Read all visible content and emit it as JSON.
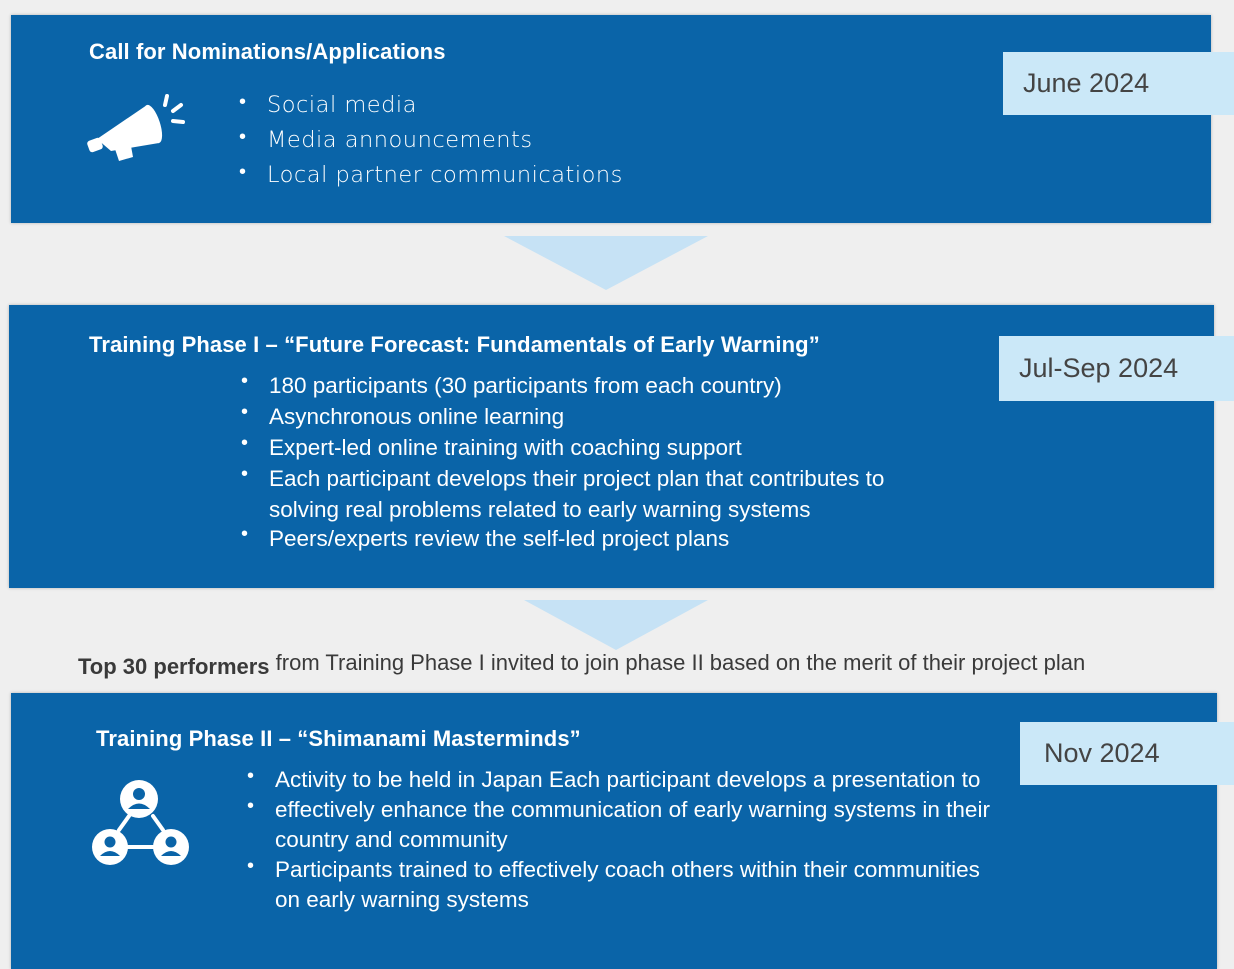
{
  "colors": {
    "panel_blue": "#0a64a8",
    "date_tag_bg": "#cbe8f8",
    "arrow_light_blue": "#c6e2f5",
    "page_bg": "#efefef"
  },
  "steps": [
    {
      "title": "Call for Nominations/Applications",
      "date": "June 2024",
      "icon": "megaphone-icon",
      "bullets": [
        "Social media",
        "Media announcements",
        "Local partner communications"
      ]
    },
    {
      "title": "Training Phase I – “Future Forecast: Fundamentals of Early Warning”",
      "date": "Jul-Sep 2024",
      "bullets": [
        "180 participants (30 participants from each country)",
        "Asynchronous online learning",
        "Expert-led online training with coaching support",
        "Each participant develops their project plan that contributes to",
        "solving real problems related to early warning systems",
        "Peers/experts review the self-led project plans"
      ]
    },
    {
      "title": "Training Phase II – “Shimanami Masterminds”",
      "date": "Nov 2024",
      "icon": "network-people-icon",
      "bullets": [
        "Activity to be held in Japan Each participant develops a presentation to",
        "effectively enhance the communication of early warning systems in their",
        "country and community",
        "Participants trained to effectively coach others within their communities",
        "on early warning systems"
      ]
    }
  ],
  "transition": {
    "bold": "Top 30 performers",
    "rest": "from Training Phase I invited to join phase II based on the merit of their project plan"
  }
}
